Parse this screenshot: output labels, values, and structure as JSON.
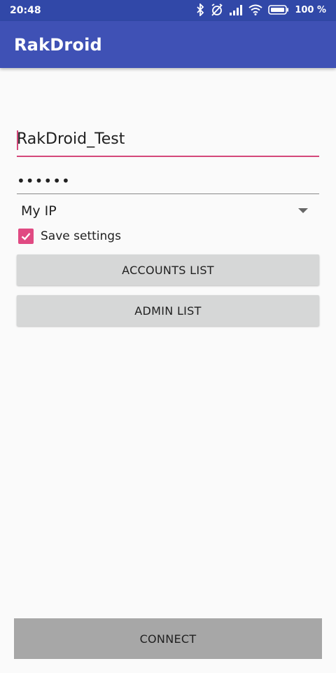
{
  "status_bar": {
    "time": "20:48",
    "battery": "100 %",
    "icons": [
      "bluetooth-icon",
      "alarm-off-icon",
      "signal-icon",
      "wifi-icon",
      "battery-icon"
    ]
  },
  "app_bar": {
    "title": "RakDroid"
  },
  "form": {
    "username": "RakDroid_Test",
    "password": "••••••",
    "server_selected": "My IP",
    "save_settings_label": "Save settings",
    "save_settings_checked": true
  },
  "buttons": {
    "accounts_list": "ACCOUNTS LIST",
    "admin_list": "ADMIN LIST",
    "connect": "CONNECT"
  },
  "colors": {
    "primary": "#3f51b5",
    "primary_dark": "#3148a8",
    "accent": "#e04a82"
  }
}
